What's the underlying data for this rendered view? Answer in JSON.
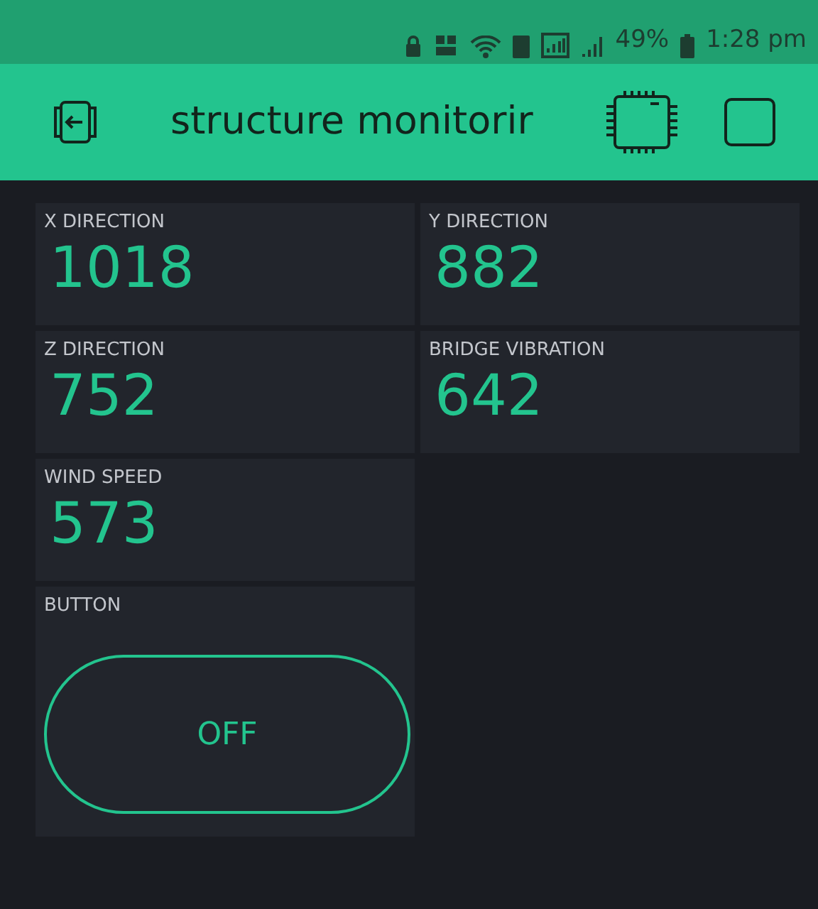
{
  "status_bar": {
    "battery_text": "49%",
    "time": "1:28 pm"
  },
  "header": {
    "title": "structure monitorir"
  },
  "widgets": [
    {
      "kind": "display",
      "label": "X DIRECTION",
      "value": "1018"
    },
    {
      "kind": "display",
      "label": "Y DIRECTION",
      "value": "882"
    },
    {
      "kind": "display",
      "label": "Z DIRECTION",
      "value": "752"
    },
    {
      "kind": "display",
      "label": "BRIDGE VIBRATION",
      "value": "642"
    },
    {
      "kind": "display",
      "label": "WIND SPEED",
      "value": "573"
    },
    {
      "kind": "button",
      "label": "BUTTON",
      "text": "OFF",
      "on": false
    }
  ]
}
